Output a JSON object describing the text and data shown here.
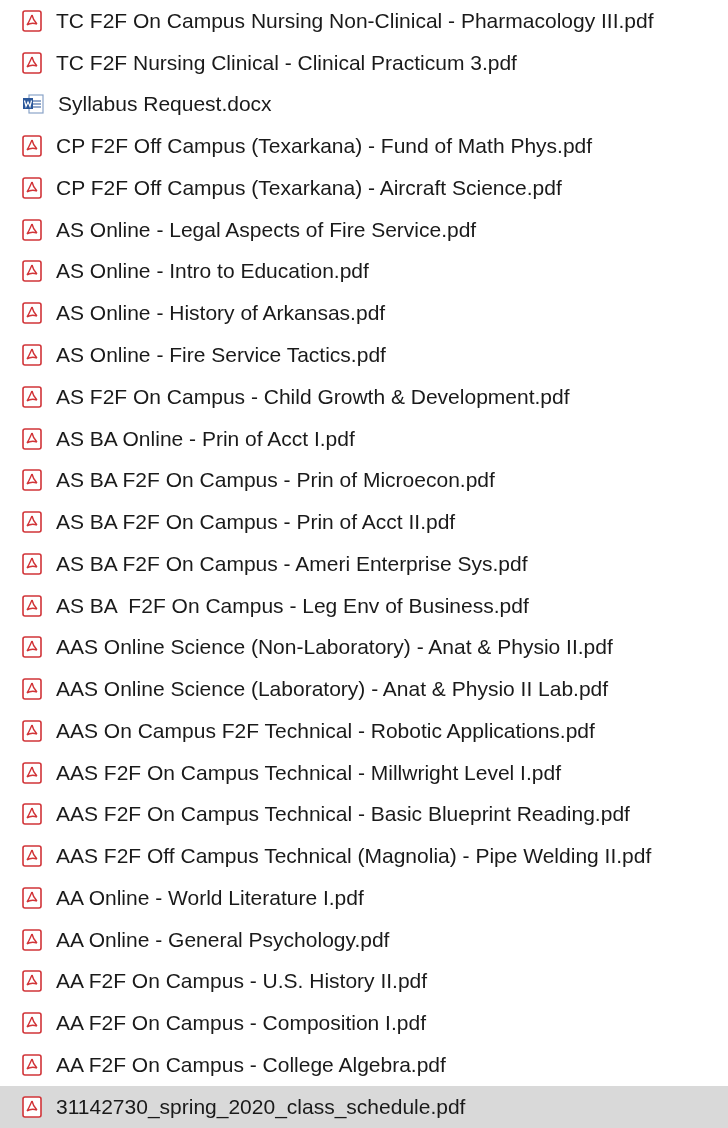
{
  "files": [
    {
      "name": "TC F2F On Campus Nursing Non-Clinical - Pharmacology III.pdf",
      "kind": "pdf",
      "selected": false
    },
    {
      "name": "TC F2F Nursing Clinical - Clinical Practicum 3.pdf",
      "kind": "pdf",
      "selected": false
    },
    {
      "name": "Syllabus Request.docx",
      "kind": "docx",
      "selected": false
    },
    {
      "name": "CP F2F Off Campus (Texarkana) - Fund of Math Phys.pdf",
      "kind": "pdf",
      "selected": false
    },
    {
      "name": "CP F2F Off Campus (Texarkana) - Aircraft Science.pdf",
      "kind": "pdf",
      "selected": false
    },
    {
      "name": "AS Online - Legal Aspects of Fire Service.pdf",
      "kind": "pdf",
      "selected": false
    },
    {
      "name": "AS Online - Intro to Education.pdf",
      "kind": "pdf",
      "selected": false
    },
    {
      "name": "AS Online - History of Arkansas.pdf",
      "kind": "pdf",
      "selected": false
    },
    {
      "name": "AS Online - Fire Service Tactics.pdf",
      "kind": "pdf",
      "selected": false
    },
    {
      "name": "AS F2F On Campus - Child Growth & Development.pdf",
      "kind": "pdf",
      "selected": false
    },
    {
      "name": "AS BA Online - Prin of Acct I.pdf",
      "kind": "pdf",
      "selected": false
    },
    {
      "name": "AS BA F2F On Campus - Prin of Microecon.pdf",
      "kind": "pdf",
      "selected": false
    },
    {
      "name": "AS BA F2F On Campus - Prin of Acct II.pdf",
      "kind": "pdf",
      "selected": false
    },
    {
      "name": "AS BA F2F On Campus - Ameri Enterprise Sys.pdf",
      "kind": "pdf",
      "selected": false
    },
    {
      "name": "AS BA  F2F On Campus - Leg Env of Business.pdf",
      "kind": "pdf",
      "selected": false
    },
    {
      "name": "AAS Online Science (Non-Laboratory) - Anat & Physio II.pdf",
      "kind": "pdf",
      "selected": false
    },
    {
      "name": "AAS Online Science (Laboratory) - Anat & Physio II Lab.pdf",
      "kind": "pdf",
      "selected": false
    },
    {
      "name": "AAS On Campus F2F Technical - Robotic Applications.pdf",
      "kind": "pdf",
      "selected": false
    },
    {
      "name": "AAS F2F On Campus Technical - Millwright Level I.pdf",
      "kind": "pdf",
      "selected": false
    },
    {
      "name": "AAS F2F On Campus Technical - Basic Blueprint Reading.pdf",
      "kind": "pdf",
      "selected": false
    },
    {
      "name": "AAS F2F Off Campus Technical (Magnolia) - Pipe Welding II.pdf",
      "kind": "pdf",
      "selected": false
    },
    {
      "name": "AA Online - World Literature I.pdf",
      "kind": "pdf",
      "selected": false
    },
    {
      "name": "AA Online - General Psychology.pdf",
      "kind": "pdf",
      "selected": false
    },
    {
      "name": "AA F2F On Campus - U.S. History II.pdf",
      "kind": "pdf",
      "selected": false
    },
    {
      "name": "AA F2F On Campus - Composition I.pdf",
      "kind": "pdf",
      "selected": false
    },
    {
      "name": "AA F2F On Campus - College Algebra.pdf",
      "kind": "pdf",
      "selected": false
    },
    {
      "name": "31142730_spring_2020_class_schedule.pdf",
      "kind": "pdf",
      "selected": true
    }
  ]
}
